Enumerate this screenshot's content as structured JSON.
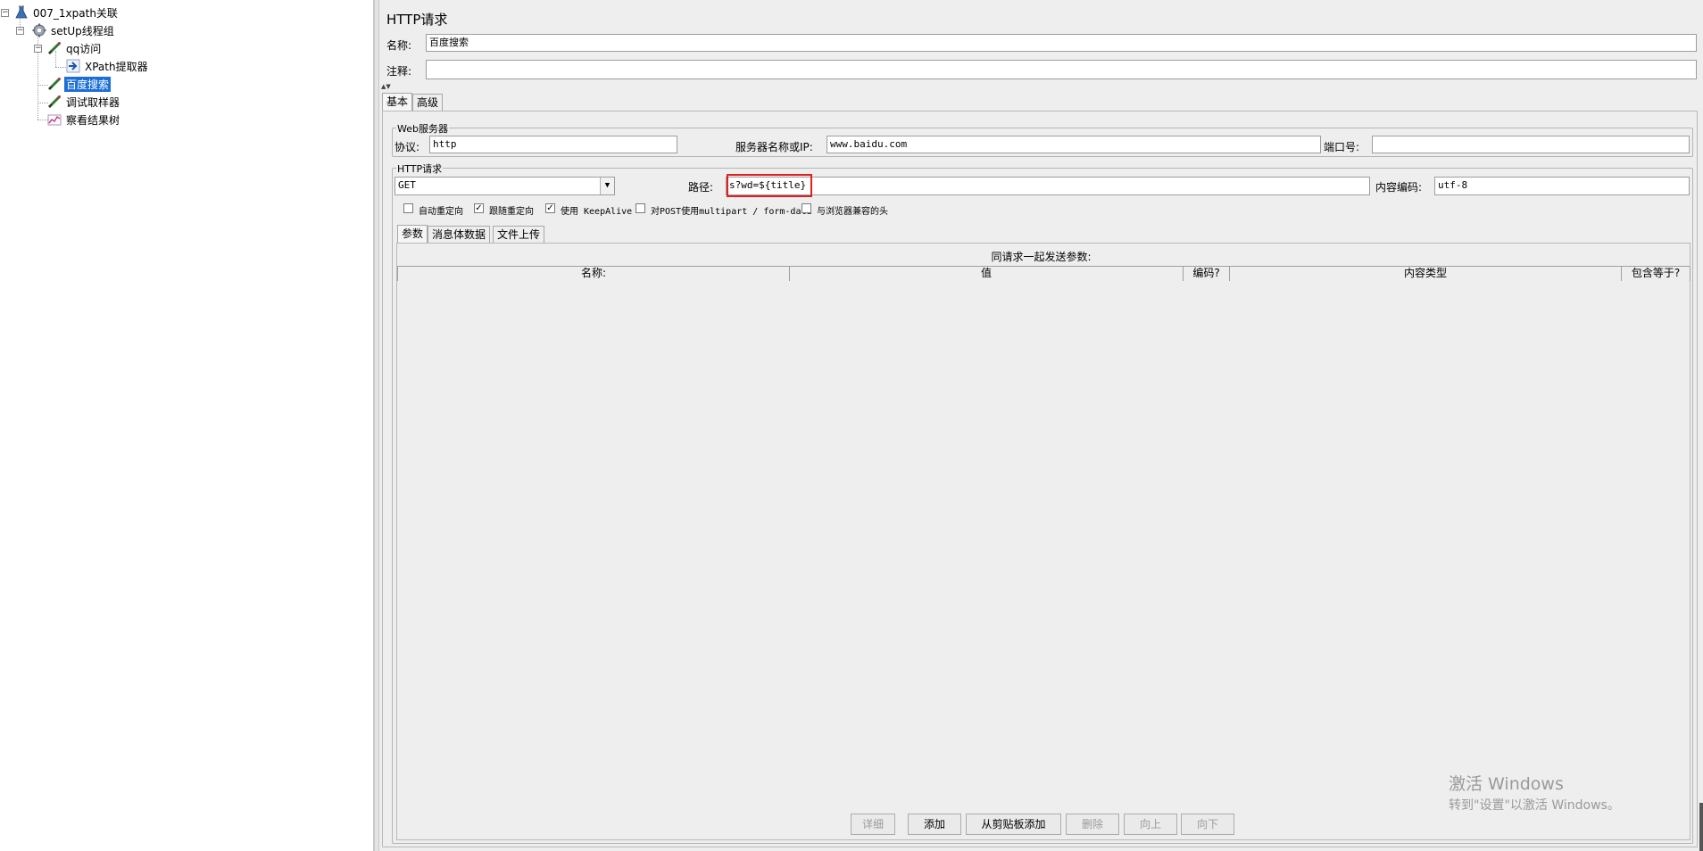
{
  "tree": {
    "root": {
      "label": "007_1xpath关联",
      "icon": "test-plan-flask-icon"
    },
    "setup_group": {
      "label": "setUp线程组",
      "icon": "gear-icon"
    },
    "qq_sampler": {
      "label": "qq访问",
      "icon": "sampler-pen-icon"
    },
    "xpath_extractor": {
      "label": "XPath提取器",
      "icon": "extractor-arrow-icon"
    },
    "baidu_sampler": {
      "label": "百度搜索",
      "icon": "sampler-pen-icon",
      "selected": true
    },
    "debug_sampler": {
      "label": "调试取样器",
      "icon": "sampler-pen-icon"
    },
    "result_tree": {
      "label": "察看结果树",
      "icon": "listener-graph-icon"
    }
  },
  "panel": {
    "title": "HTTP请求",
    "name_label": "名称:",
    "name_value": "百度搜索",
    "comment_label": "注释:",
    "comment_value": "",
    "tabs": [
      {
        "label": "基本",
        "active": true
      },
      {
        "label": "高级",
        "active": false
      }
    ],
    "web_server": {
      "group_title": "Web服务器",
      "protocol_label": "协议:",
      "protocol_value": "http",
      "server_label": "服务器名称或IP:",
      "server_value": "www.baidu.com",
      "port_label": "端口号:",
      "port_value": ""
    },
    "http_request": {
      "group_title": "HTTP请求",
      "method_value": "GET",
      "path_label": "路径:",
      "path_value": "s?wd=${title}",
      "encoding_label": "内容编码:",
      "encoding_value": "utf-8",
      "checkboxes": [
        {
          "label": "自动重定向",
          "checked": false
        },
        {
          "label": "跟随重定向",
          "checked": true
        },
        {
          "label": "使用 KeepAlive",
          "checked": true
        },
        {
          "label": "对POST使用multipart / form-data",
          "checked": false
        },
        {
          "label": "与浏览器兼容的头",
          "checked": false
        }
      ],
      "check_mark": "✓"
    },
    "sub_tabs": [
      {
        "label": "参数",
        "active": true
      },
      {
        "label": "消息体数据",
        "active": false
      },
      {
        "label": "文件上传",
        "active": false
      }
    ],
    "params_caption": "同请求一起发送参数:",
    "columns": [
      "名称:",
      "值",
      "编码?",
      "内容类型",
      "包含等于?"
    ],
    "buttons": [
      {
        "label": "详细",
        "enabled": false
      },
      {
        "label": "添加",
        "enabled": true
      },
      {
        "label": "从剪贴板添加",
        "enabled": true
      },
      {
        "label": "删除",
        "enabled": false
      },
      {
        "label": "向上",
        "enabled": false
      },
      {
        "label": "向下",
        "enabled": false
      }
    ],
    "highlight_color": "#e02020"
  },
  "watermark": {
    "line1": "激活 Windows",
    "line2": "转到\"设置\"以激活 Windows。"
  }
}
